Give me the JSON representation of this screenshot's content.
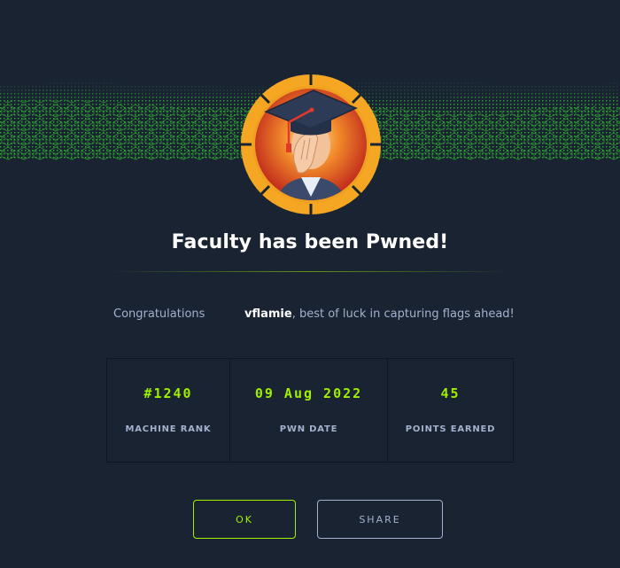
{
  "dialog": {
    "title": "Faculty has been Pwned!",
    "congrats_label": "Congratulations",
    "username": "vflamie",
    "message_suffix": ", best of luck in capturing flags ahead!"
  },
  "stats": [
    {
      "value": "#1240",
      "label": "MACHINE RANK"
    },
    {
      "value": "09 Aug 2022",
      "label": "PWN DATE"
    },
    {
      "value": "45",
      "label": "POINTS EARNED"
    }
  ],
  "buttons": {
    "ok_label": "OK",
    "share_label": "SHARE"
  },
  "colors": {
    "background": "#1a2332",
    "accent": "#9fef00",
    "text": "#a4b1cd",
    "badge_ring": "#f5a623"
  },
  "icons": {
    "badge": "graduation-cap-facepalm-badge",
    "banner": "green-cube-wave-banner"
  }
}
